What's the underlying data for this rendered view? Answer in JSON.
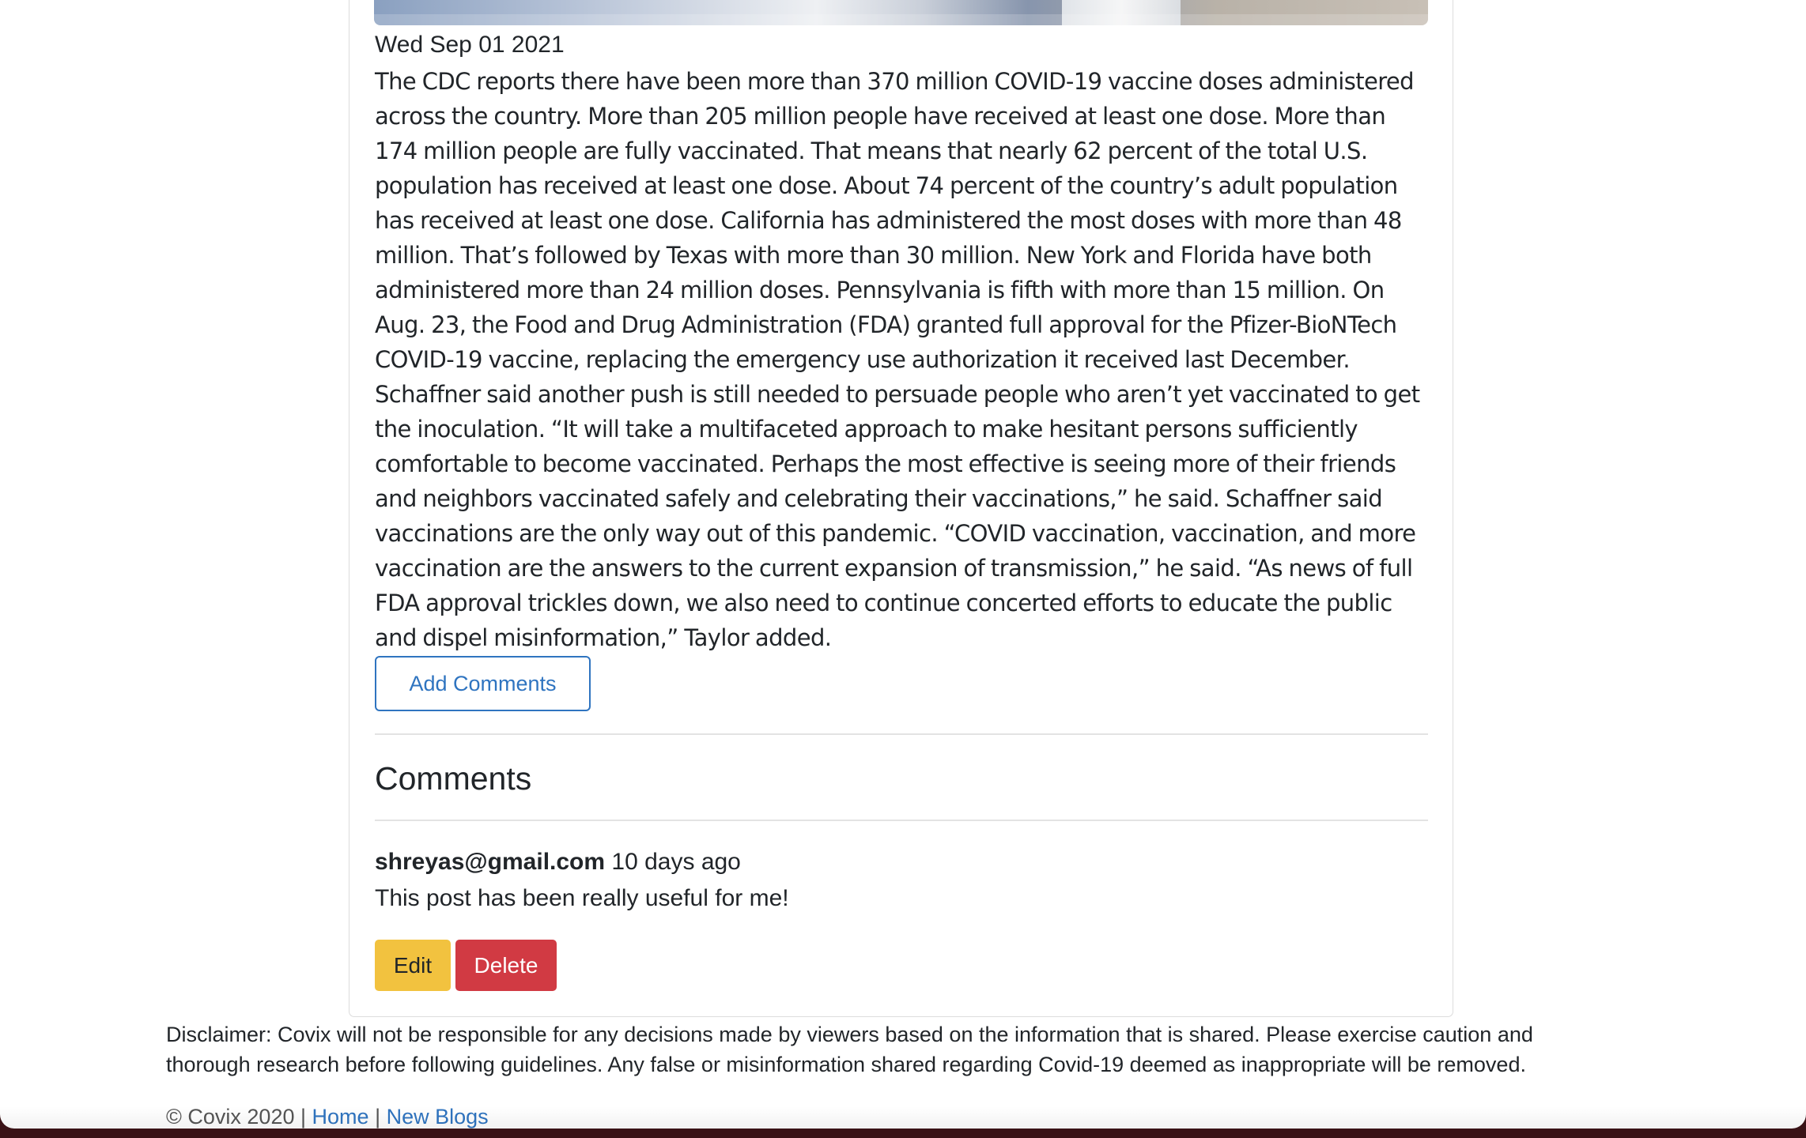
{
  "post": {
    "image_alt_icon": "vaccine-photo",
    "date": "Wed Sep 01 2021",
    "body_lines": [
      "The CDC reports there have been more than 370 million COVID-19 vaccine doses administered",
      "across the country. More than 205 million people have received at least one dose. More than",
      "174 million people are fully vaccinated. That means that nearly 62 percent of the total U.S.",
      "population has received at least one dose. About 74 percent of the country’s adult population",
      "has received at least one dose. California has administered the most doses with more than 48",
      "million. That’s followed by Texas with more than 30 million. New York and Florida have both",
      "administered more than 24 million doses. Pennsylvania is fifth with more than 15 million. On",
      "Aug. 23, the Food and Drug Administration (FDA) granted full approval for the Pfizer-BioNTech",
      "COVID-19 vaccine, replacing the emergency use authorization it received last December.",
      "Schaffner said another push is still needed to persuade people who aren’t yet vaccinated to get",
      "the inoculation. “It will take a multifaceted approach to make hesitant persons sufficiently",
      "comfortable to become vaccinated. Perhaps the most effective is seeing more of their friends",
      "and neighbors vaccinated safely and celebrating their vaccinations,” he said. Schaffner said",
      "vaccinations are the only way out of this pandemic. “COVID vaccination, vaccination, and more",
      "vaccination are the answers to the current expansion of transmission,” he said. “As news of full",
      "FDA approval trickles down, we also need to continue concerted efforts to educate the public",
      "and dispel misinformation,” Taylor added."
    ],
    "add_comments_label": "Add Comments"
  },
  "comments": {
    "heading": "Comments",
    "items": [
      {
        "author": "shreyas@gmail.com",
        "time": "10 days ago",
        "text": "This post has been really useful for me!",
        "edit_label": "Edit",
        "delete_label": "Delete"
      }
    ]
  },
  "footer": {
    "disclaimer_line1": "Disclaimer: Covix will not be responsible for any decisions made by viewers based on the information that is shared. Please exercise caution and",
    "disclaimer_line2": "thorough research before following guidelines. Any false or misinformation shared regarding Covid-19 deemed as inappropriate will be removed.",
    "copyright": "© Covix 2020",
    "separator": "|",
    "home_link": "Home",
    "new_blogs_link": "New Blogs"
  },
  "colors": {
    "primary": "#2f74c0",
    "warning": "#f2c23f",
    "danger": "#d13a43"
  }
}
